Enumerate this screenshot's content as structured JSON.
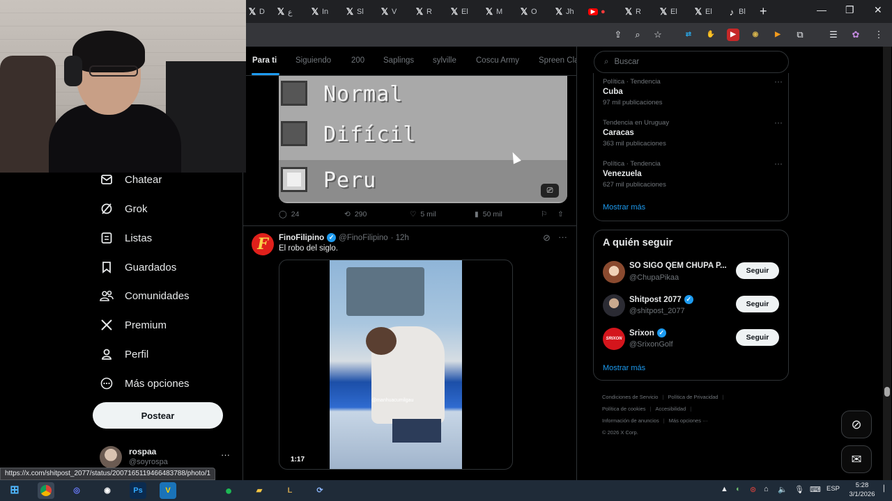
{
  "browser": {
    "tabs": [
      {
        "icon": "x-logo",
        "text": "D"
      },
      {
        "icon": "x-logo",
        "text": "ع"
      },
      {
        "icon": "x-logo",
        "text": "In"
      },
      {
        "icon": "x-logo",
        "text": "Sl"
      },
      {
        "icon": "x-logo",
        "text": "V"
      },
      {
        "icon": "x-logo",
        "text": "R"
      },
      {
        "icon": "x-logo",
        "text": "El"
      },
      {
        "icon": "x-logo",
        "text": "M"
      },
      {
        "icon": "x-logo",
        "text": "O"
      },
      {
        "icon": "x-logo",
        "text": "Jh"
      },
      {
        "icon": "youtube-logo",
        "text": ""
      },
      {
        "icon": "x-logo",
        "text": "R"
      },
      {
        "icon": "x-logo",
        "text": "El"
      },
      {
        "icon": "x-logo",
        "text": "El"
      },
      {
        "icon": "tiktok-logo",
        "text": "Bl"
      }
    ],
    "new_tab": "+",
    "status_url": "https://x.com/shitpost_2077/status/2007165119466483788/photo/1"
  },
  "sidebar": {
    "items": [
      {
        "label": "Chatear",
        "icon": "chat-icon"
      },
      {
        "label": "Grok",
        "icon": "grok-icon"
      },
      {
        "label": "Listas",
        "icon": "list-icon"
      },
      {
        "label": "Guardados",
        "icon": "bookmark-icon"
      },
      {
        "label": "Comunidades",
        "icon": "communities-icon"
      },
      {
        "label": "Premium",
        "icon": "x-icon"
      },
      {
        "label": "Perfil",
        "icon": "profile-icon"
      },
      {
        "label": "Más opciones",
        "icon": "more-options-icon"
      }
    ],
    "post_button": "Postear",
    "profile": {
      "name": "rospaa",
      "handle": "@soyrospa",
      "more": "···"
    }
  },
  "feed": {
    "tabs": [
      "Para ti",
      "Siguiendo",
      "200",
      "Saplings",
      "sylville",
      "Coscu Army",
      "Spreen Cla"
    ],
    "active_tab": "Para ti",
    "tweet1": {
      "image_options": [
        "Normal",
        "Difícil",
        "Peru"
      ],
      "gif_badge": "⎚",
      "replies": "24",
      "reposts": "290",
      "likes": "5 mil",
      "views": "50 mil"
    },
    "tweet2": {
      "author": "FinoFilipino",
      "handle": "@FinoFilipino",
      "time": "· 12h",
      "text": "El robo del siglo.",
      "avatar_letter": "F",
      "video_duration": "1:17",
      "video_watermark": "@manhuacumilgau"
    }
  },
  "right": {
    "search_placeholder": "Buscar",
    "trends": [
      {
        "category": "Política · Tendencia",
        "name": "Cuba",
        "count": "97 mil publicaciones"
      },
      {
        "category": "Tendencia en Uruguay",
        "name": "Caracas",
        "count": "363 mil publicaciones"
      },
      {
        "category": "Política · Tendencia",
        "name": "Venezuela",
        "count": "627 mil publicaciones"
      }
    ],
    "show_more": "Mostrar más",
    "who_to_follow": {
      "title": "A quién seguir",
      "accounts": [
        {
          "name": "SO SIGO QEM CHUPA P...",
          "handle": "@ChupaPikaa",
          "verified": false
        },
        {
          "name": "Shitpost 2077",
          "handle": "@shitpost_2077",
          "verified": true
        },
        {
          "name": "Srixon",
          "handle": "@SrixonGolf",
          "verified": true
        }
      ],
      "follow_label": "Seguir",
      "show_more": "Mostrar más"
    },
    "footer": {
      "line1": [
        "Condiciones de Servicio",
        "Política de Privacidad"
      ],
      "line2": [
        "Política de cookies",
        "Accesibilidad"
      ],
      "line3": [
        "Información de anuncios",
        "Más opciones ···"
      ],
      "line4": "© 2026 X Corp."
    }
  },
  "taskbar": {
    "language": "ESP",
    "time": "5:28",
    "date": "3/1/2026"
  },
  "colors": {
    "accent": "#1d9bf0",
    "background": "#000000",
    "border": "#2f3336",
    "secondary_text": "#71767b"
  }
}
